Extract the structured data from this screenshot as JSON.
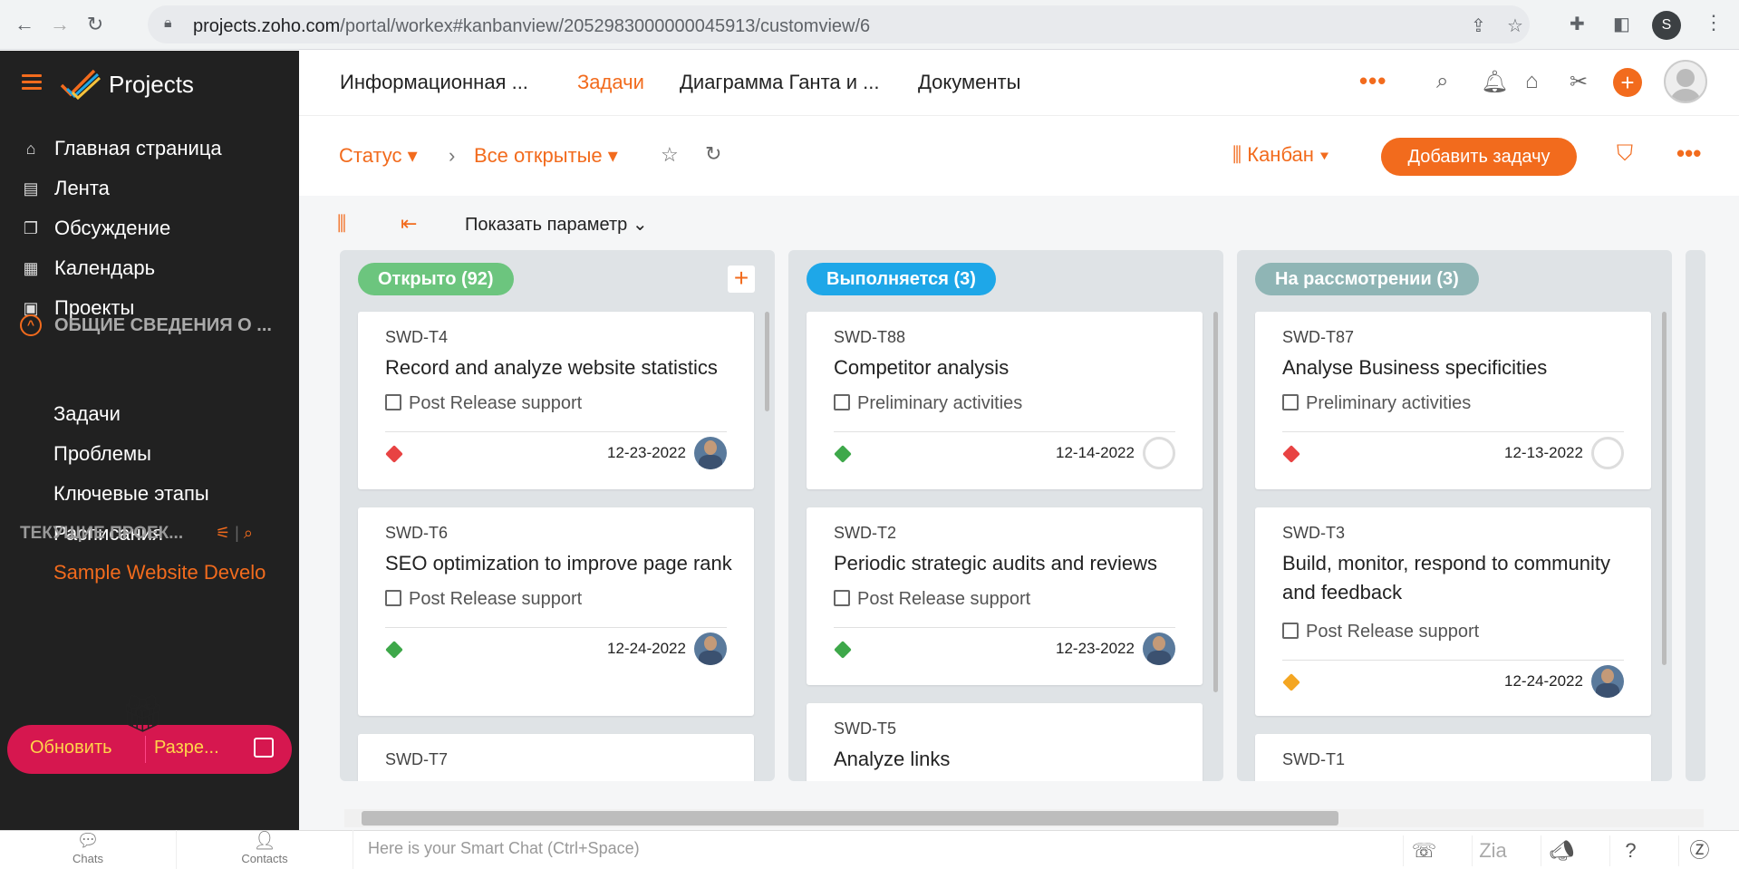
{
  "browser": {
    "url_host": "projects.zoho.com",
    "url_path": "/portal/workex#kanbanview/2052983000000045913/customview/6",
    "profile_initial": "S",
    "icons": [
      "back-icon",
      "forward-icon",
      "reload-icon",
      "lock-icon",
      "share-icon",
      "star-icon",
      "extensions-icon",
      "sidepanel-icon",
      "menu-icon"
    ]
  },
  "sidebar": {
    "app_title": "Projects",
    "nav": [
      {
        "label": "Главная страница",
        "icon": "home-icon",
        "glyph": "⌂"
      },
      {
        "label": "Лента",
        "icon": "feed-icon",
        "glyph": "▤"
      },
      {
        "label": "Обсуждение",
        "icon": "discussion-icon",
        "glyph": "❐"
      },
      {
        "label": "Календарь",
        "icon": "calendar-icon",
        "glyph": "▦"
      },
      {
        "label": "Проекты",
        "icon": "projects-icon",
        "glyph": "▣"
      }
    ],
    "section_header": "ОБЩИЕ СВЕДЕНИЯ О ...",
    "section_items": [
      "Задачи",
      "Проблемы",
      "Ключевые этапы",
      "Расписания"
    ],
    "current_projects_label": "ТЕКУЩИЕ ПРОЕК...",
    "current_project": "Sample Website Develo",
    "upgrade_label": "Обновить",
    "explore_label": "Разре..."
  },
  "topnav": {
    "tabs": [
      {
        "label": "Информационная ...",
        "active": false
      },
      {
        "label": "Задачи",
        "active": true
      },
      {
        "label": "Диаграмма Ганта и ...",
        "active": false
      },
      {
        "label": "Документы",
        "active": false
      }
    ],
    "more": "•••",
    "icons": [
      "search-icon",
      "bell-icon",
      "store-icon",
      "tools-icon",
      "plus-icon",
      "profile-avatar"
    ]
  },
  "filterbar": {
    "status_label": "Статус",
    "view_label": "Все открытые",
    "kanban_label": "Канбан",
    "add_task_label": "Добавить задачу",
    "accent": "#f26b1d"
  },
  "board_toolbar": {
    "show_param_label": "Показать параметр"
  },
  "columns": [
    {
      "label": "Открыто (92)",
      "color": "#6cc57e",
      "cards": [
        {
          "id": "SWD-T4",
          "title": "Record and analyze website statistics",
          "list": "Post Release support",
          "priority": "high",
          "date": "12-23-2022",
          "avatar": "person"
        },
        {
          "id": "SWD-T6",
          "title": "SEO optimization to improve page rank",
          "list": "Post Release support",
          "priority": "low",
          "date": "12-24-2022",
          "avatar": "person"
        },
        {
          "id": "SWD-T7",
          "title": "",
          "list": "",
          "priority": "",
          "date": "",
          "avatar": ""
        }
      ]
    },
    {
      "label": "Выполняется (3)",
      "color": "#1ea7e8",
      "cards": [
        {
          "id": "SWD-T88",
          "title": "Competitor analysis",
          "list": "Preliminary activities",
          "priority": "low",
          "date": "12-14-2022",
          "avatar": "empty"
        },
        {
          "id": "SWD-T2",
          "title": "Periodic strategic audits and reviews",
          "list": "Post Release support",
          "priority": "low",
          "date": "12-23-2022",
          "avatar": "person"
        },
        {
          "id": "SWD-T5",
          "title": "Analyze links",
          "list": "",
          "priority": "",
          "date": "",
          "avatar": ""
        }
      ]
    },
    {
      "label": "На рассмотрении (3)",
      "color": "#8fb5b5",
      "cards": [
        {
          "id": "SWD-T87",
          "title": "Analyse Business specificities",
          "list": "Preliminary activities",
          "priority": "high",
          "date": "12-13-2022",
          "avatar": "empty"
        },
        {
          "id": "SWD-T3",
          "title": "Build, monitor, respond to community and feedback",
          "list": "Post Release support",
          "priority": "medium",
          "date": "12-24-2022",
          "avatar": "person"
        },
        {
          "id": "SWD-T1",
          "title": "",
          "list": "",
          "priority": "",
          "date": "",
          "avatar": ""
        }
      ]
    }
  ],
  "priority_colors": {
    "high": "#e84343",
    "low": "#3ea84a",
    "medium": "#f4a622"
  },
  "bottombar": {
    "chats_label": "Chats",
    "contacts_label": "Contacts",
    "smartchat_placeholder": "Here is your Smart Chat (Ctrl+Space)"
  }
}
